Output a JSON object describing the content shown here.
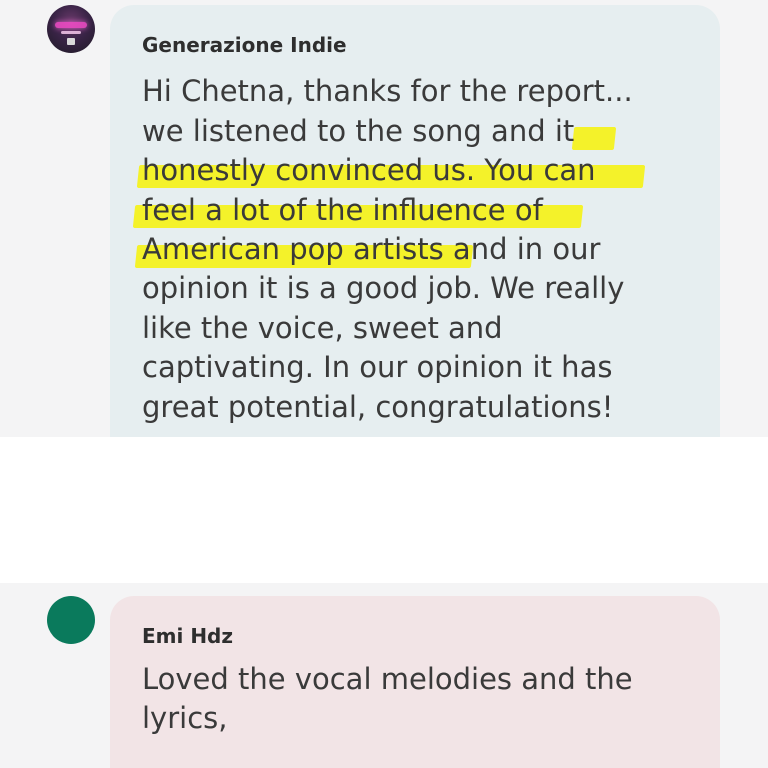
{
  "comments": [
    {
      "author": "Generazione Indie",
      "lines": [
        {
          "pre": "Hi Chetna, thanks for the report...",
          "hl": "",
          "post": ""
        },
        {
          "pre": "we listened to the song and",
          "hl": " it",
          "post": ""
        },
        {
          "pre": "",
          "hl": "honestly convinced us. You can",
          "post": ""
        },
        {
          "pre": "",
          "hl": "feel a lot of the influence of",
          "post": ""
        },
        {
          "pre": "",
          "hl": "American pop artists",
          "post": " and in our"
        },
        {
          "pre": "opinion it is a good job. We really",
          "hl": "",
          "post": ""
        },
        {
          "pre": "like the voice, sweet and",
          "hl": "",
          "post": ""
        },
        {
          "pre": "captivating. In our opinion it has",
          "hl": "",
          "post": ""
        },
        {
          "pre": "great potential, congratulations!",
          "hl": "",
          "post": ""
        }
      ],
      "avatar_icon": "neon-sign-avatar"
    },
    {
      "author": "Emi Hdz",
      "lines": [
        {
          "pre": "Loved the vocal melodies and the",
          "hl": "",
          "post": ""
        },
        {
          "pre": "lyrics,",
          "hl": "",
          "post": ""
        }
      ],
      "avatar_color": "#0a7a5c"
    }
  ],
  "colors": {
    "highlight": "#f4f22a",
    "bubble_1": "#e6eef0",
    "bubble_2": "#f2e4e6",
    "panel": "#f4f4f5"
  }
}
